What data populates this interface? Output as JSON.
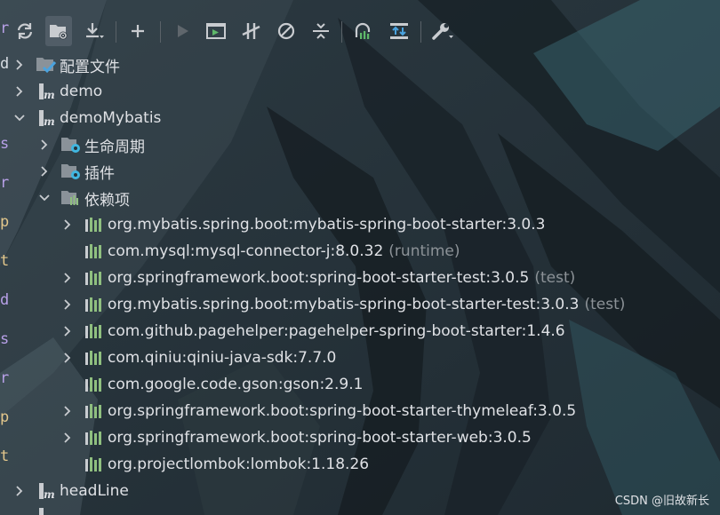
{
  "toolbar": {
    "buttons": [
      {
        "name": "reload-all-icon",
        "tip": "Reload"
      },
      {
        "name": "generate-sources-icon",
        "tip": "Generate sources"
      },
      {
        "name": "download-icon",
        "tip": "Download"
      },
      {
        "name": "add-icon",
        "tip": "Add"
      },
      {
        "name": "run-icon",
        "tip": "Run"
      },
      {
        "name": "execute-goal-icon",
        "tip": "Execute goal"
      },
      {
        "name": "toggle-offline-icon",
        "tip": "Toggle offline"
      },
      {
        "name": "skip-tests-icon",
        "tip": "Skip tests"
      },
      {
        "name": "collapse-all-icon",
        "tip": "Collapse all"
      },
      {
        "name": "show-dependencies-icon",
        "tip": "Show dependencies"
      },
      {
        "name": "analyze-dependencies-icon",
        "tip": "Analyze dependencies"
      },
      {
        "name": "settings-wrench-icon",
        "tip": "Settings"
      }
    ]
  },
  "tree": {
    "items": [
      {
        "label": "配置文件",
        "scope": ""
      },
      {
        "label": "demo",
        "scope": ""
      },
      {
        "label": "demoMybatis",
        "scope": ""
      },
      {
        "label": "生命周期",
        "scope": ""
      },
      {
        "label": "插件",
        "scope": ""
      },
      {
        "label": "依赖项",
        "scope": ""
      },
      {
        "label": "org.mybatis.spring.boot:mybatis-spring-boot-starter:3.0.3",
        "scope": ""
      },
      {
        "label": "com.mysql:mysql-connector-j:8.0.32",
        "scope": "(runtime)"
      },
      {
        "label": "org.springframework.boot:spring-boot-starter-test:3.0.5",
        "scope": "(test)"
      },
      {
        "label": "org.mybatis.spring.boot:mybatis-spring-boot-starter-test:3.0.3",
        "scope": "(test)"
      },
      {
        "label": "com.github.pagehelper:pagehelper-spring-boot-starter:1.4.6",
        "scope": ""
      },
      {
        "label": "com.qiniu:qiniu-java-sdk:7.7.0",
        "scope": ""
      },
      {
        "label": "com.google.code.gson:gson:2.9.1",
        "scope": ""
      },
      {
        "label": "org.springframework.boot:spring-boot-starter-thymeleaf:3.0.5",
        "scope": ""
      },
      {
        "label": "org.springframework.boot:spring-boot-starter-web:3.0.5",
        "scope": ""
      },
      {
        "label": "org.projectlombok:lombok:1.18.26",
        "scope": ""
      },
      {
        "label": "headLine",
        "scope": ""
      }
    ]
  },
  "left_strip_glyphs": [
    "r",
    "d",
    "s",
    "r",
    "p",
    "t",
    "d",
    "s",
    "r",
    "p",
    "t"
  ],
  "watermark": "CSDN @旧故新长",
  "colors": {
    "accent_blue": "#3592c4",
    "gear_blue": "#40b6e0",
    "maven_m": "#dfe1e5",
    "bars": "#8fbf7f",
    "check_blue": "#4aa3df"
  }
}
